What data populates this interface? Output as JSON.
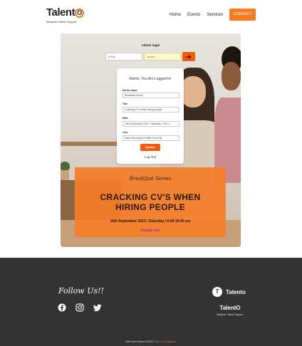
{
  "header": {
    "logo_text_a": "Talent",
    "logo_text_b": "O",
    "tagline": "Bespoke Talent Support",
    "nav": [
      "Home",
      "Events",
      "Services"
    ],
    "contact_label": "CONTACT"
  },
  "admin": {
    "title": "Admin login",
    "email_placeholder": "Email",
    "password_value": "••••••••"
  },
  "card": {
    "title": "Admin, You Are Logged In!",
    "fields": [
      {
        "label": "Series name",
        "value": "Breakfast Series"
      },
      {
        "label": "Title",
        "value": "Cracking CV's when hiring people"
      },
      {
        "label": "Date",
        "value": "16th September 2023 / Saturday / 9:00-1"
      },
      {
        "label": "Link",
        "value": "https://forms.gle/xYMBfn7eYmRB"
      }
    ],
    "update_label": "Update",
    "logout_label": "Log Out"
  },
  "event": {
    "series": "Breakfast Series",
    "title_line1": "CRACKING CV'S WHEN",
    "title_line2": "HIRING PEOPLE",
    "date": "16th September 2023 / Saturday / 9:00-10:00 am",
    "link": "Google Link"
  },
  "footer": {
    "follow": "Follow Us!!",
    "logo_badge": "T",
    "logo_word": "Talento",
    "brand": "TalentO",
    "tagline": "Bespoke Talent Support",
    "copyright": "Web Victor Banco 2023 © ",
    "terms": "Terms & Conditions"
  },
  "colors": {
    "accent": "#f47b20",
    "button": "#f05a0a",
    "footer_bg": "#333333"
  },
  "icons": [
    "arrow-right-icon",
    "facebook-icon",
    "instagram-icon",
    "twitter-icon"
  ]
}
